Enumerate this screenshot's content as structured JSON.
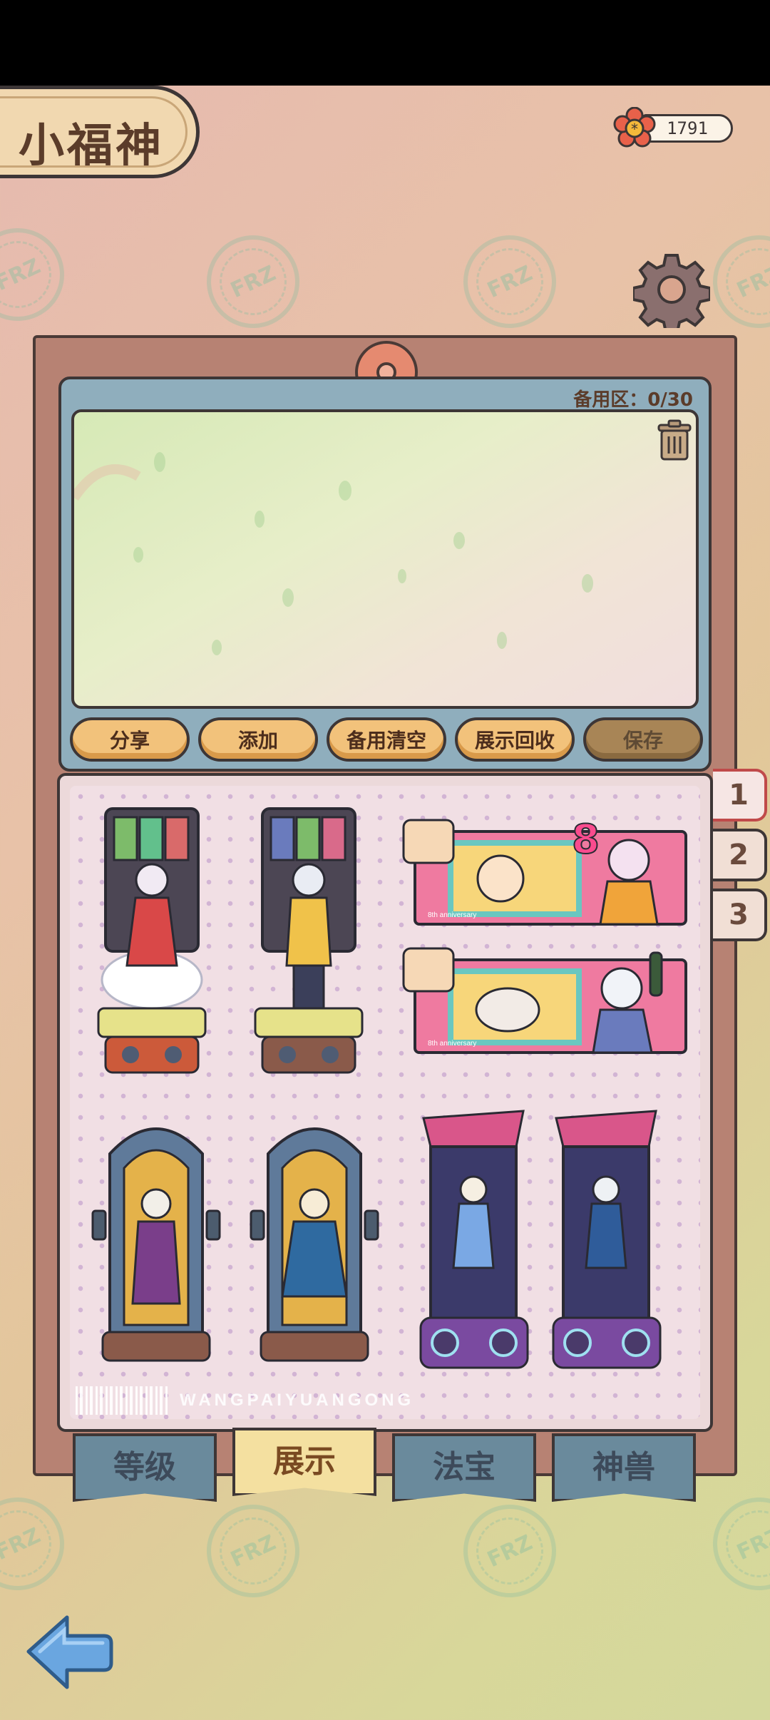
{
  "header": {
    "title": "小福神",
    "currency_value": "1791"
  },
  "reserve": {
    "label": "备用区：0/30",
    "buttons": [
      {
        "label": "分享",
        "enabled": true
      },
      {
        "label": "添加",
        "enabled": true
      },
      {
        "label": "备用清空",
        "enabled": true
      },
      {
        "label": "展示回收",
        "enabled": true
      },
      {
        "label": "保存",
        "enabled": false
      }
    ]
  },
  "board": {
    "brand_text": "WANGPAIYUANGONG",
    "banner_text": "8th anniversary"
  },
  "page_tabs": [
    "1",
    "2",
    "3"
  ],
  "active_page": "1",
  "bottom_tabs": [
    "等级",
    "展示",
    "法宝",
    "神兽"
  ],
  "active_bottom_tab": "展示",
  "stamp_text": "FRZ",
  "colors": {
    "accent_button": "#f2c27b",
    "panel_blue": "#8faebd",
    "active_tab": "#f4e0a0",
    "inactive_tab": "#6a8a9c"
  }
}
